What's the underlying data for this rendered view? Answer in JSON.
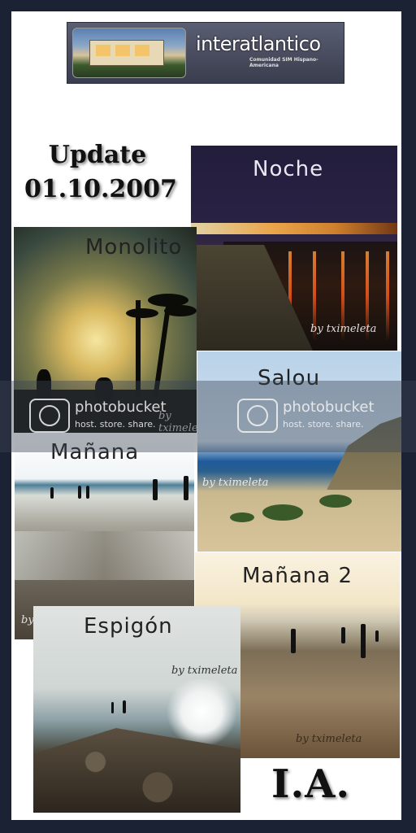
{
  "banner": {
    "title": "interatlantico",
    "subtitle": "Comunidad SIM Hispano-Americana"
  },
  "update": {
    "line1": "Update",
    "line2": "01.10.2007"
  },
  "photos": {
    "noche": {
      "label": "Noche",
      "credit": "by tximeleta"
    },
    "monolito": {
      "label": "Monolito",
      "credit": "by tximeleta"
    },
    "salou": {
      "label": "Salou",
      "credit": "by tximeleta"
    },
    "manana": {
      "label": "Mañana",
      "credit": "by"
    },
    "manana2": {
      "label": "Mañana 2",
      "credit": "by tximeleta"
    },
    "espigon": {
      "label": "Espigón",
      "credit": "by tximeleta"
    }
  },
  "watermark": {
    "name": "photobucket",
    "tagline": "host. store. share."
  },
  "signature": "I.A.",
  "colors": {
    "frame": "#1a2233",
    "page": "#ffffff",
    "banner": "#4a4d5e"
  }
}
